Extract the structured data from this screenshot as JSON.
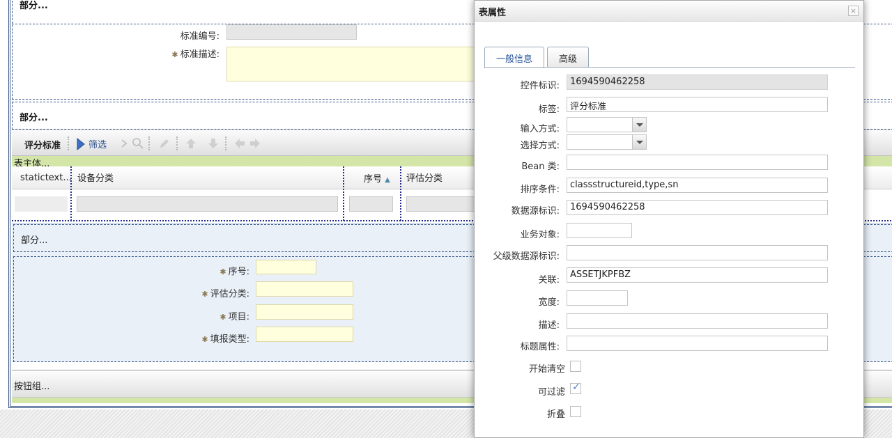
{
  "canvas": {
    "section1": {
      "title": "部分..."
    },
    "standard_code": {
      "label": "标准编号:"
    },
    "standard_desc": {
      "label": "标准描述:"
    },
    "section2": {
      "title": "部分..."
    },
    "toolbar": {
      "title": "评分标准",
      "filter_label": "筛选"
    },
    "table_body": {
      "label": "表主体..."
    },
    "grid": {
      "columns": [
        {
          "label": "statictext..."
        },
        {
          "label": "设备分类"
        },
        {
          "label": "序号"
        },
        {
          "label": "评估分类"
        }
      ]
    },
    "section3": {
      "title": "部分..."
    },
    "form": {
      "seq": {
        "label": "序号:"
      },
      "eval_category": {
        "label": "评估分类:"
      },
      "item": {
        "label": "项目:"
      },
      "report_type": {
        "label": "填报类型:"
      }
    },
    "button_group": {
      "label": "按钮组..."
    }
  },
  "dialog": {
    "title": "表属性",
    "close_icon": "×",
    "tabs": [
      {
        "label": "一般信息",
        "active": true
      },
      {
        "label": "高级",
        "active": false
      }
    ],
    "fields": {
      "control_id": {
        "label": "控件标识:",
        "value": "1694590462258"
      },
      "caption": {
        "label": "标签:",
        "value": "评分标准"
      },
      "input_mode": {
        "label": "输入方式:",
        "value": ""
      },
      "select_mode": {
        "label": "选择方式:",
        "value": ""
      },
      "bean_class": {
        "label": "Bean 类:",
        "value": ""
      },
      "order_by": {
        "label": "排序条件:",
        "value": "classstructureid,type,sn"
      },
      "datasrc": {
        "label": "数据源标识:",
        "value": "1694590462258"
      },
      "mbo_name": {
        "label": "业务对象:",
        "value": ""
      },
      "parent_datasrc": {
        "label": "父级数据源标识:",
        "value": ""
      },
      "relationship": {
        "label": "关联:",
        "value": "ASSETJKPFBZ"
      },
      "width": {
        "label": "宽度:",
        "value": ""
      },
      "description": {
        "label": "描述:",
        "value": ""
      },
      "label_attrs": {
        "label": "标题属性:",
        "value": ""
      },
      "start_empty": {
        "label": "开始清空",
        "checked": false
      },
      "filterable": {
        "label": "可过滤",
        "checked": true
      },
      "collapsible": {
        "label": "折叠",
        "checked": false
      }
    }
  },
  "colors": {
    "frame_blue": "#3c5a8a",
    "green_band": "#d4e5a8",
    "panel_blue": "#e9f0f8",
    "required_input": "#ffffdd",
    "tab_active_text": "#1f4f97"
  }
}
